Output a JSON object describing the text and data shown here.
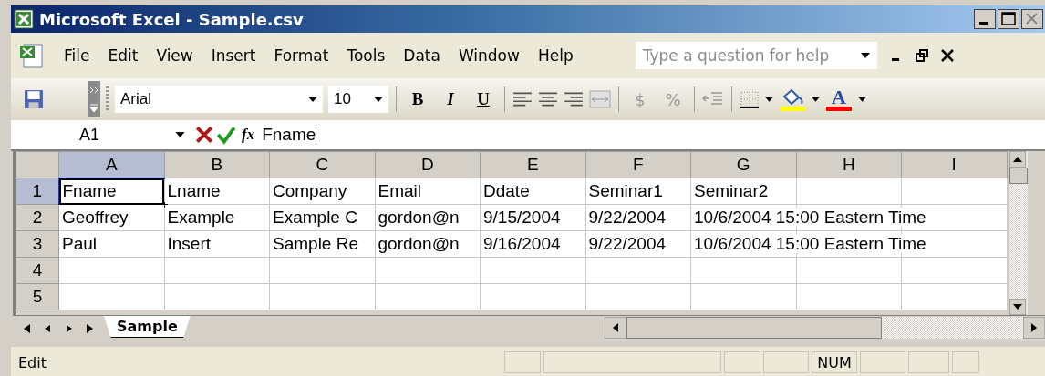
{
  "window": {
    "title": "Microsoft Excel - Sample.csv"
  },
  "menu": [
    {
      "label": "File"
    },
    {
      "label": "Edit"
    },
    {
      "label": "View"
    },
    {
      "label": "Insert"
    },
    {
      "label": "Format"
    },
    {
      "label": "Tools"
    },
    {
      "label": "Data"
    },
    {
      "label": "Window"
    },
    {
      "label": "Help"
    }
  ],
  "help_search": {
    "placeholder": "Type a question for help"
  },
  "toolbar": {
    "font": "Arial",
    "size": "10",
    "format_buttons": [
      {
        "label": "B",
        "kind": "bold"
      },
      {
        "label": "I",
        "kind": "italic"
      },
      {
        "label": "U",
        "kind": "underline"
      }
    ],
    "number_buttons": [
      {
        "label": "$",
        "disabled": true
      },
      {
        "label": "%",
        "disabled": true
      }
    ],
    "font_color": {
      "label": "A"
    }
  },
  "formula_bar": {
    "name_box": "A1",
    "fx": "fx",
    "value": "Fname"
  },
  "sheet": {
    "columns": [
      {
        "label": "A",
        "selected": true
      },
      {
        "label": "B",
        "selected": false
      },
      {
        "label": "C",
        "selected": false
      },
      {
        "label": "D",
        "selected": false
      },
      {
        "label": "E",
        "selected": false
      },
      {
        "label": "F",
        "selected": false
      },
      {
        "label": "G",
        "selected": false
      },
      {
        "label": "H",
        "selected": false
      },
      {
        "label": "I",
        "selected": false
      }
    ],
    "rows": [
      {
        "label": "1",
        "selected": true,
        "cells": [
          "Fname",
          "Lname",
          "Company",
          "Email",
          "Ddate",
          "Seminar1",
          "Seminar2"
        ]
      },
      {
        "label": "2",
        "selected": false,
        "cells": [
          "Geoffrey",
          "Example",
          "Example C",
          "gordon@n",
          "9/15/2004",
          "9/22/2004",
          "10/6/2004 15:00 Eastern Time"
        ]
      },
      {
        "label": "3",
        "selected": false,
        "cells": [
          "Paul",
          "Insert",
          "Sample Re",
          "gordon@n",
          "9/16/2004",
          "9/22/2004",
          "10/6/2004 15:00 Eastern Time"
        ]
      },
      {
        "label": "4",
        "selected": false,
        "cells": []
      },
      {
        "label": "5",
        "selected": false,
        "cells": []
      }
    ]
  },
  "sheet_tabs": [
    {
      "label": "Sample",
      "selected": true
    }
  ],
  "status_bar": {
    "mode": "Edit",
    "indicators": [
      "NUM"
    ]
  }
}
